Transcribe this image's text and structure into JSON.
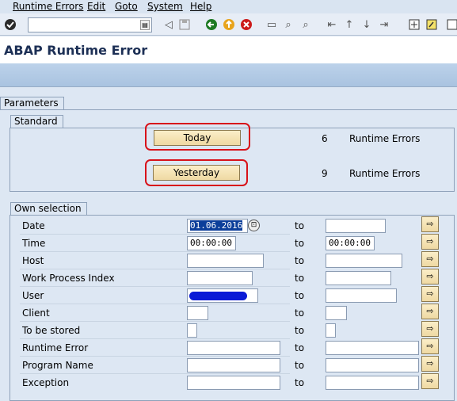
{
  "menu": [
    "Runtime Errors",
    "Edit",
    "Goto",
    "System",
    "Help"
  ],
  "toolbar": {
    "command_value": "",
    "icons": [
      "check-icon",
      "save-icon",
      "back-icon",
      "exit-icon",
      "cancel-icon",
      "print-icon",
      "find-icon",
      "find-next-icon",
      "first-page-icon",
      "prev-page-icon",
      "next-page-icon",
      "last-page-icon",
      "layout-icon",
      "help-icon",
      "customize-icon"
    ]
  },
  "title": "ABAP Runtime Error",
  "tabs": {
    "parameters": "Parameters",
    "standard": "Standard",
    "own_selection": "Own selection"
  },
  "standard": {
    "today_label": "Today",
    "today_count": "6",
    "yesterday_label": "Yesterday",
    "yesterday_count": "9",
    "count_suffix": "Runtime Errors"
  },
  "own_selection": {
    "to_label": "to",
    "rows": [
      {
        "label": "Date",
        "from": "01.06.2016",
        "to": ""
      },
      {
        "label": "Time",
        "from": "00:00:00",
        "to": "00:00:00"
      },
      {
        "label": "Host",
        "from": "",
        "to": ""
      },
      {
        "label": "Work Process Index",
        "from": "",
        "to": ""
      },
      {
        "label": "User",
        "from": "",
        "to": ""
      },
      {
        "label": "Client",
        "from": "",
        "to": ""
      },
      {
        "label": "To be stored",
        "from": "",
        "to": ""
      },
      {
        "label": "Runtime Error",
        "from": "",
        "to": ""
      },
      {
        "label": "Program Name",
        "from": "",
        "to": ""
      },
      {
        "label": "Exception",
        "from": "",
        "to": ""
      }
    ]
  },
  "colors": {
    "highlight": "#d8121a",
    "button_bg": "#f4e2b2",
    "redacted": "#0b1bd6"
  }
}
